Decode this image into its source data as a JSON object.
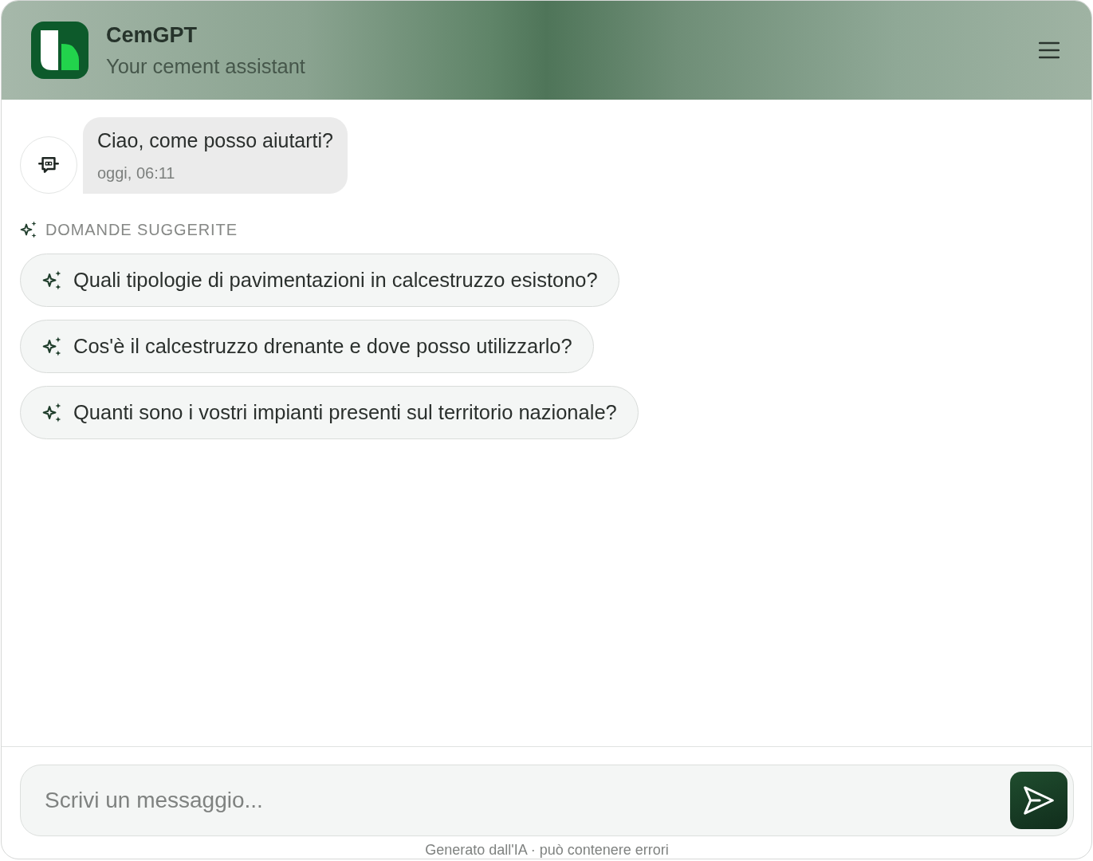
{
  "header": {
    "title": "CemGPT",
    "subtitle": "Your cement assistant"
  },
  "messages": [
    {
      "kind": "bot",
      "text": "Ciao, come posso aiutarti?",
      "time": "oggi, 06:11"
    }
  ],
  "suggestions": {
    "label": "DOMANDE SUGGERITE",
    "items": [
      "Quali tipologie di pavimentazioni in calcestruzzo esistono?",
      "Cos'è il calcestruzzo drenante e dove posso utilizzarlo?",
      "Quanti sono i vostri impianti presenti sul territorio nazionale?"
    ]
  },
  "composer": {
    "placeholder": "Scrivi un messaggio..."
  },
  "footer": "Generato dall'IA · può contenere errori"
}
